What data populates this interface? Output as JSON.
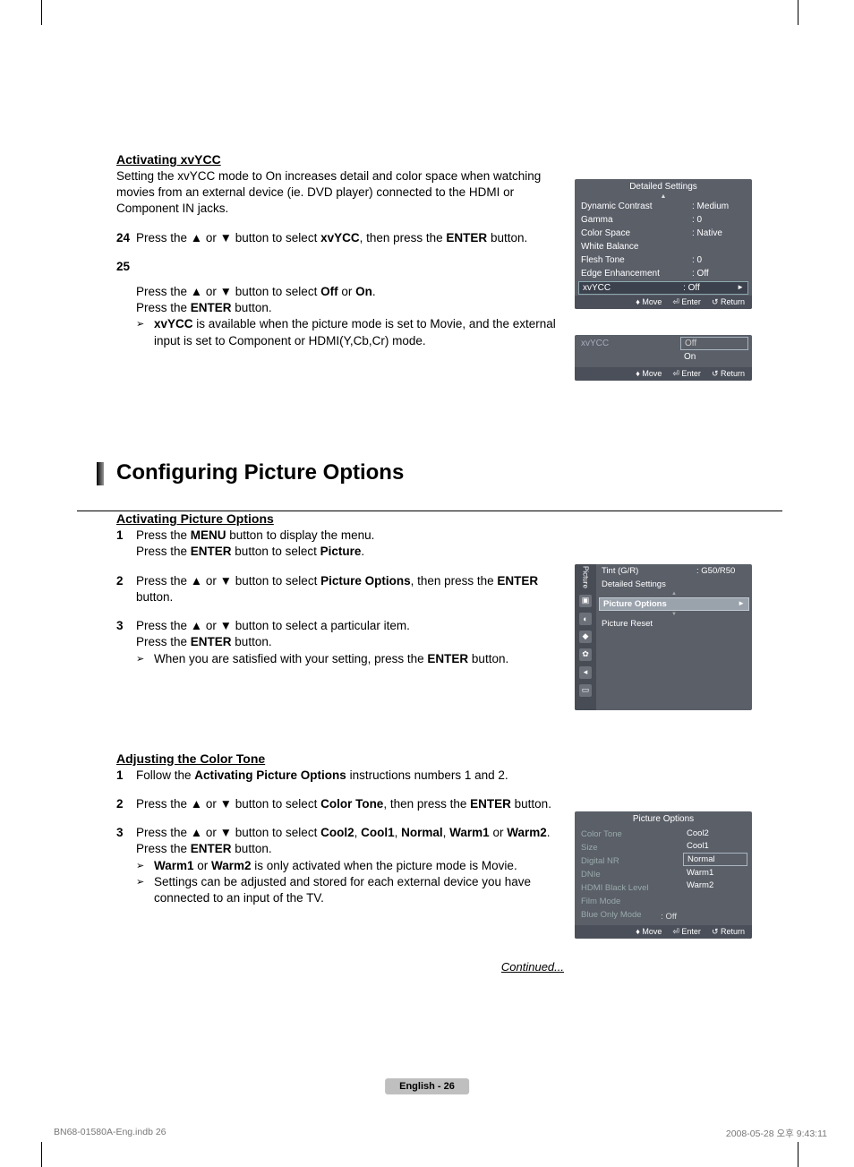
{
  "section_a": {
    "heading": "Activating xvYCC",
    "intro": "Setting the xvYCC mode to On increases detail and color space when watching movies from an external device (ie. DVD player) connected to the HDMI or Component IN jacks.",
    "step24_num": "24",
    "step24": "Press the ▲ or ▼ button to select xvYCC, then press the ENTER button.",
    "step25_num": "25",
    "step25_a": "Press the ▲ or ▼ button to select Off or On.",
    "step25_b": "Press the ENTER button.",
    "step25_note_pre": "xvYCC",
    "step25_note": " is available when the picture mode is set to Movie, and the external input is set to Component or HDMI(Y,Cb,Cr) mode."
  },
  "osd1": {
    "title": "Detailed Settings",
    "rows": [
      {
        "lbl": "Dynamic Contrast",
        "val": ": Medium"
      },
      {
        "lbl": "Gamma",
        "val": ": 0"
      },
      {
        "lbl": "Color Space",
        "val": ": Native"
      },
      {
        "lbl": "White Balance",
        "val": ""
      },
      {
        "lbl": "Flesh Tone",
        "val": ": 0"
      },
      {
        "lbl": "Edge Enhancement",
        "val": ": Off"
      },
      {
        "lbl": "xvYCC",
        "val": ": Off"
      }
    ],
    "footer_move": "Move",
    "footer_enter": "Enter",
    "footer_return": "Return"
  },
  "osd2": {
    "label": "xvYCC",
    "opt_off": "Off",
    "opt_on": "On",
    "footer_move": "Move",
    "footer_enter": "Enter",
    "footer_return": "Return"
  },
  "section_title": "Configuring Picture Options",
  "section_b": {
    "heading": "Activating Picture Options",
    "s1_num": "1",
    "s1_a": "Press the MENU button to display the menu.",
    "s1_b": "Press the ENTER button to select Picture.",
    "s2_num": "2",
    "s2": "Press the ▲ or ▼ button to select Picture Options, then press the ENTER button.",
    "s3_num": "3",
    "s3_a": "Press the ▲ or ▼ button to select a particular item.",
    "s3_b": "Press the ENTER button.",
    "s3_note": "When you are satisfied with your setting, press the ENTER button."
  },
  "osd3": {
    "side_label": "Picture",
    "r1_lbl": "Tint (G/R)",
    "r1_val": ": G50/R50",
    "r2_lbl": "Detailed Settings",
    "r3_lbl": "Picture Options",
    "r4_lbl": "Picture Reset"
  },
  "section_c": {
    "heading": "Adjusting the Color Tone",
    "s1_num": "1",
    "s1": "Follow the Activating Picture Options instructions numbers 1 and 2.",
    "s2_num": "2",
    "s2": "Press the ▲ or ▼ button to select Color Tone, then press the ENTER button.",
    "s3_num": "3",
    "s3_a": "Press the ▲ or ▼ button to select Cool2, Cool1, Normal, Warm1 or Warm2.",
    "s3_b": "Press the ENTER button.",
    "s3_note1": "Warm1 or Warm2 is only activated when the picture mode is Movie.",
    "s3_note2": "Settings can be adjusted and stored for each external device you have connected to an input of the TV."
  },
  "osd4": {
    "title": "Picture Options",
    "labels": [
      "Color Tone",
      "Size",
      "Digital NR",
      "DNIe",
      "HDMI Black Level",
      "Film Mode",
      "Blue Only Mode"
    ],
    "opts": [
      "Cool2",
      "Cool1",
      "Normal",
      "Warm1",
      "Warm2"
    ],
    "extra_val": ": Off",
    "footer_move": "Move",
    "footer_enter": "Enter",
    "footer_return": "Return"
  },
  "continued": "Continued...",
  "page_tag": "English - 26",
  "footer_left": "BN68-01580A-Eng.indb   26",
  "footer_right": "2008-05-28   오후 9:43:11"
}
